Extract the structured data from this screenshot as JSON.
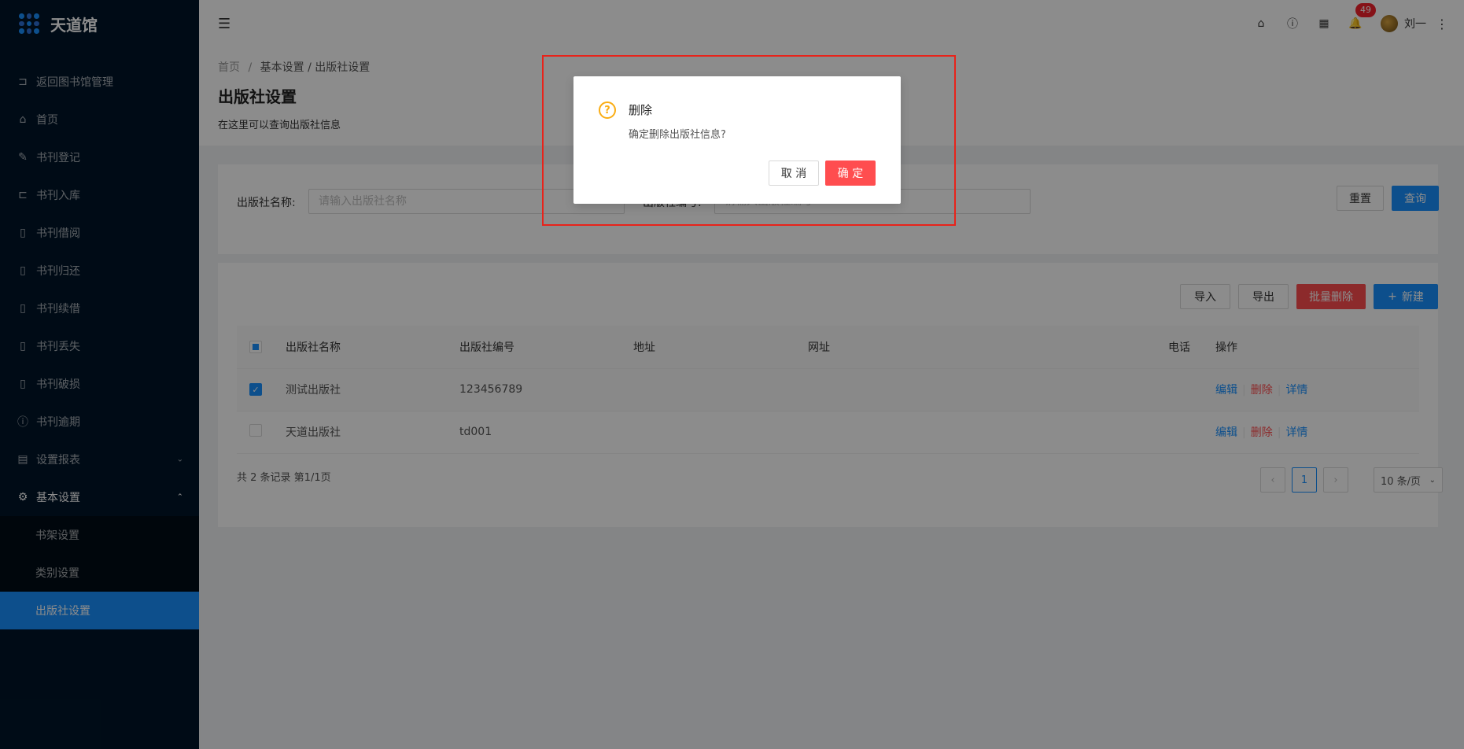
{
  "app": {
    "logo_text": "天道馆"
  },
  "sidebar": {
    "items": [
      {
        "label": "返回图书馆管理",
        "icon": "return-icon"
      },
      {
        "label": "首页",
        "icon": "home-icon"
      },
      {
        "label": "书刊登记",
        "icon": "pen-icon"
      },
      {
        "label": "书刊入库",
        "icon": "login-icon"
      },
      {
        "label": "书刊借阅",
        "icon": "book-icon"
      },
      {
        "label": "书刊归还",
        "icon": "book-icon"
      },
      {
        "label": "书刊续借",
        "icon": "book-icon"
      },
      {
        "label": "书刊丢失",
        "icon": "book-icon"
      },
      {
        "label": "书刊破损",
        "icon": "book-icon"
      },
      {
        "label": "书刊逾期",
        "icon": "exclamation-icon"
      },
      {
        "label": "设置报表",
        "icon": "report-icon"
      },
      {
        "label": "基本设置",
        "icon": "gear-icon"
      }
    ],
    "sub_items": [
      {
        "label": "书架设置"
      },
      {
        "label": "类别设置"
      },
      {
        "label": "出版社设置"
      }
    ]
  },
  "header": {
    "notification_count": "49",
    "user_name": "刘一"
  },
  "breadcrumb": {
    "home": "首页",
    "sep": "/",
    "section": "基本设置 / 出版社设置"
  },
  "page": {
    "title": "出版社设置",
    "description": "在这里可以查询出版社信息"
  },
  "search": {
    "name_label": "出版社名称:",
    "name_placeholder": "请输入出版社名称",
    "code_label": "出版社编号:",
    "code_placeholder": "请输入出版社编号",
    "reset_label": "重置",
    "query_label": "查询"
  },
  "toolbar": {
    "import_label": "导入",
    "export_label": "导出",
    "batch_delete_label": "批量删除",
    "new_label": "新建"
  },
  "table": {
    "columns": [
      "出版社名称",
      "出版社编号",
      "地址",
      "网址",
      "电话",
      "操作"
    ],
    "rows": [
      {
        "name": "测试出版社",
        "code": "123456789",
        "address": "",
        "url": "",
        "phone": "",
        "checked": true
      },
      {
        "name": "天道出版社",
        "code": "td001",
        "address": "",
        "url": "",
        "phone": "",
        "checked": false
      }
    ],
    "actions": {
      "edit": "编辑",
      "delete": "删除",
      "detail": "详情"
    }
  },
  "pagination": {
    "summary": "共 2 条记录 第1/1页",
    "current_page": "1",
    "page_size": "10 条/页"
  },
  "modal": {
    "title": "删除",
    "content": "确定删除出版社信息?",
    "cancel_label": "取 消",
    "ok_label": "确 定"
  },
  "colors": {
    "primary": "#1890ff",
    "danger": "#ff4d4f",
    "sidebar_bg": "#001529",
    "warning": "#faad14",
    "highlight": "#e8231a"
  }
}
